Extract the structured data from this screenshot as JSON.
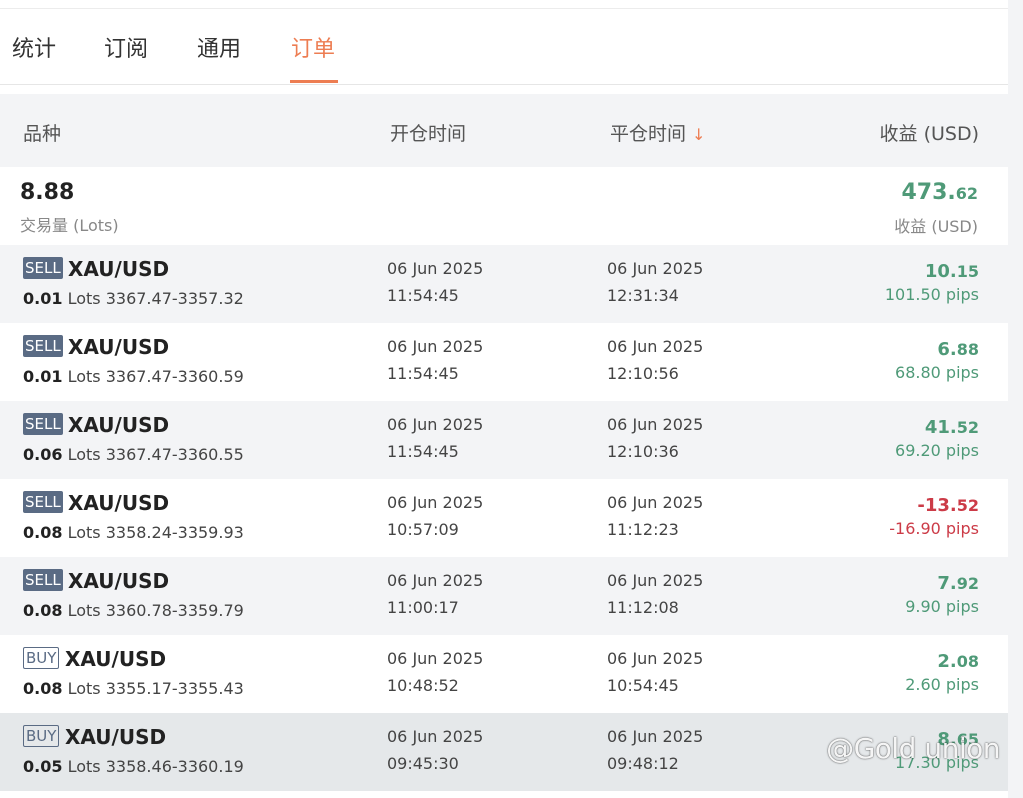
{
  "tabs": [
    {
      "label": "统计"
    },
    {
      "label": "订阅"
    },
    {
      "label": "通用"
    },
    {
      "label": "订单"
    }
  ],
  "columns": {
    "symbol": "品种",
    "open_time": "开仓时间",
    "close_time": "平仓时间",
    "sort_icon": "↓",
    "profit": "收益 (USD)"
  },
  "summary": {
    "lots": "8.88",
    "lots_label": "交易量 (Lots)",
    "profit_int": "473.",
    "profit_dec": "62",
    "profit_label": "收益 (USD)"
  },
  "orders": [
    {
      "side": "SELL",
      "symbol": "XAU/USD",
      "lots": "0.01",
      "lots_unit": "Lots",
      "range": "3367.47-3357.32",
      "open_date": "06 Jun 2025",
      "open_time": "11:54:45",
      "close_date": "06 Jun 2025",
      "close_time": "12:31:34",
      "profit_int": "10.",
      "profit_dec": "15",
      "pips": "101.50 pips"
    },
    {
      "side": "SELL",
      "symbol": "XAU/USD",
      "lots": "0.01",
      "lots_unit": "Lots",
      "range": "3367.47-3360.59",
      "open_date": "06 Jun 2025",
      "open_time": "11:54:45",
      "close_date": "06 Jun 2025",
      "close_time": "12:10:56",
      "profit_int": "6.",
      "profit_dec": "88",
      "pips": "68.80 pips"
    },
    {
      "side": "SELL",
      "symbol": "XAU/USD",
      "lots": "0.06",
      "lots_unit": "Lots",
      "range": "3367.47-3360.55",
      "open_date": "06 Jun 2025",
      "open_time": "11:54:45",
      "close_date": "06 Jun 2025",
      "close_time": "12:10:36",
      "profit_int": "41.",
      "profit_dec": "52",
      "pips": "69.20 pips"
    },
    {
      "side": "SELL",
      "symbol": "XAU/USD",
      "lots": "0.08",
      "lots_unit": "Lots",
      "range": "3358.24-3359.93",
      "open_date": "06 Jun 2025",
      "open_time": "10:57:09",
      "close_date": "06 Jun 2025",
      "close_time": "11:12:23",
      "profit_int": "-13.",
      "profit_dec": "52",
      "pips": "-16.90 pips"
    },
    {
      "side": "SELL",
      "symbol": "XAU/USD",
      "lots": "0.08",
      "lots_unit": "Lots",
      "range": "3360.78-3359.79",
      "open_date": "06 Jun 2025",
      "open_time": "11:00:17",
      "close_date": "06 Jun 2025",
      "close_time": "11:12:08",
      "profit_int": "7.",
      "profit_dec": "92",
      "pips": "9.90 pips"
    },
    {
      "side": "BUY",
      "symbol": "XAU/USD",
      "lots": "0.08",
      "lots_unit": "Lots",
      "range": "3355.17-3355.43",
      "open_date": "06 Jun 2025",
      "open_time": "10:48:52",
      "close_date": "06 Jun 2025",
      "close_time": "10:54:45",
      "profit_int": "2.",
      "profit_dec": "08",
      "pips": "2.60 pips"
    },
    {
      "side": "BUY",
      "symbol": "XAU/USD",
      "lots": "0.05",
      "lots_unit": "Lots",
      "range": "3358.46-3360.19",
      "open_date": "06 Jun 2025",
      "open_time": "09:45:30",
      "close_date": "06 Jun 2025",
      "close_time": "09:48:12",
      "profit_int": "8.",
      "profit_dec": "65",
      "pips": "17.30 pips"
    }
  ],
  "watermark": "@Gold union",
  "colors": {
    "accent": "#ed7d52",
    "positive": "#4f9a78",
    "negative": "#cc3b47",
    "sell_badge": "#5a6b84"
  }
}
